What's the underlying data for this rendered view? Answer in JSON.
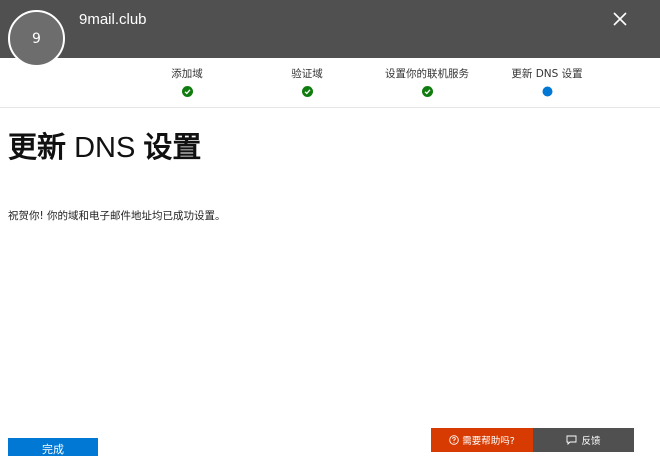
{
  "header": {
    "avatar_text": "9",
    "domain_name": "9mail.club"
  },
  "steps": [
    {
      "label": "添加域",
      "status": "complete"
    },
    {
      "label": "验证域",
      "status": "complete"
    },
    {
      "label": "设置你的联机服务",
      "status": "complete"
    },
    {
      "label": "更新 DNS 设置",
      "status": "current"
    }
  ],
  "main": {
    "title_part1": "更新",
    "title_part2": " DNS ",
    "title_part3": "设置",
    "message": "祝贺你! 你的域和电子邮件地址均已成功设置。"
  },
  "footer": {
    "done_label": "完成",
    "help_label": "需要帮助吗?",
    "feedback_label": "反馈"
  },
  "colors": {
    "header_bg": "#505050",
    "complete_green": "#107c10",
    "current_blue": "#0078d4",
    "primary_button": "#0078d4",
    "help_button": "#d83b01"
  }
}
